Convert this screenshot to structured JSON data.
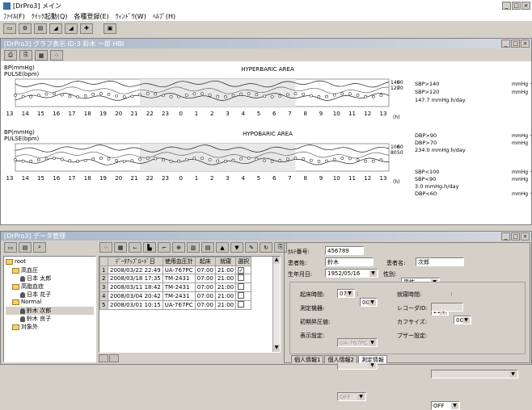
{
  "app": {
    "title": "[DrPro3] メイン",
    "menu": [
      "ﾌｧｲﾙ(F)",
      "ｸｲｯｸ起動(Q)",
      "各種登録(E)",
      "ｳｨﾝﾄﾞｳ(W)",
      "ﾍﾙﾌﾟ(H)"
    ]
  },
  "graph_window": {
    "title": "[DrPro3] グラフ表示 ID:3 鈴木 一郎 HBI",
    "top_chart": {
      "title": "HYPERBARIC AREA",
      "ylabel1": "BP(mmHg)",
      "ylabel2": "PULSE(bpm)",
      "right_axis": [
        "140",
        "120",
        "90",
        "70"
      ],
      "legend": [
        {
          "label": "SBP>140",
          "unit": "mmHg +"
        },
        {
          "label": "SBP>120",
          "unit": "mmHg"
        },
        {
          "label": "147.7 mmHg.h/day",
          "unit": ""
        }
      ]
    },
    "bottom_chart": {
      "title": "HYPOBARIC AREA",
      "ylabel1": "BP(mmHg)",
      "ylabel2": "PULSE(bpm)",
      "right_axis": [
        "100",
        "80",
        "60",
        "50"
      ],
      "legend": [
        {
          "label": "DBP>90",
          "unit": "mmHg +"
        },
        {
          "label": "DBP>70",
          "unit": "mmHg"
        },
        {
          "label": "234.0 mmHg.h/day",
          "unit": ""
        },
        {
          "label": "SBP<100",
          "unit": "mmHg +"
        },
        {
          "label": "SBP<90",
          "unit": "mmHg"
        },
        {
          "label": "3.0 mmHg.h/day",
          "unit": ""
        },
        {
          "label": "DBP<60",
          "unit": "mmHg +"
        }
      ]
    },
    "x_ticks": [
      "13",
      "14",
      "15",
      "16",
      "17",
      "18",
      "19",
      "20",
      "21",
      "22",
      "23",
      "0",
      "1",
      "2",
      "3",
      "4",
      "5",
      "6",
      "7",
      "8",
      "9",
      "10",
      "11",
      "12",
      "13"
    ],
    "x_unit": "(h)"
  },
  "data_window": {
    "title": "[DrPro3] データ管理",
    "tree": [
      "root",
      "高血圧",
      "日本 太郎",
      "高脂血症",
      "日本 花子",
      "Normal",
      "鈴木 次郎",
      "鈴木 良子",
      "対象外"
    ],
    "table_headers": [
      "",
      "ﾃﾞｰﾀｱｯﾌﾟﾛｰﾄﾞ日",
      "使用血圧計",
      "起床",
      "就寝",
      "選択"
    ],
    "rows": [
      {
        "n": "1",
        "date": "2008/03/22 22:49",
        "dev": "UA-767PC",
        "wake": "07:00",
        "sleep": "21:00",
        "sel": "✓"
      },
      {
        "n": "2",
        "date": "2008/03/18 17:35",
        "dev": "TM-2431",
        "wake": "07:00",
        "sleep": "21:00",
        "sel": ""
      },
      {
        "n": "3",
        "date": "2008/03/11 18:42",
        "dev": "TM-2431",
        "wake": "07:00",
        "sleep": "21:00",
        "sel": ""
      },
      {
        "n": "4",
        "date": "2008/03/04 20:42",
        "dev": "TM-2431",
        "wake": "07:00",
        "sleep": "21:00",
        "sel": ""
      },
      {
        "n": "5",
        "date": "2008/03/01 10:15",
        "dev": "UA-767PC",
        "wake": "07:00",
        "sleep": "21:00",
        "sel": ""
      }
    ],
    "form": {
      "chart_no_label": "ｶﾙﾃ番号:",
      "chart_no": "456789",
      "surname_label": "患者姓:",
      "surname": "鈴木",
      "given_label": "患者名:",
      "given": "次郎",
      "dob_label": "生年月日:",
      "dob": "1952/05/16",
      "sex_label": "性別:",
      "sex": "男性",
      "wake_label": "起床時間:",
      "wake_h": "07",
      "wake_m": "00",
      "sleep_label": "就寝時間:",
      "sleep_h": "21",
      "sleep_m": "00",
      "device_label": "測定機器:",
      "device": "UA-767PC",
      "recorder_label": "レコーダID:",
      "init_label": "初期昇圧値:",
      "cuff_label": "カフサイズ:",
      "display_label": "表示設定:",
      "display": "OFF",
      "buzzer_label": "ブザー設定:",
      "buzzer": "OFF",
      "tabs": [
        "個人情報1",
        "個人情報2",
        "測定情報"
      ]
    }
  }
}
